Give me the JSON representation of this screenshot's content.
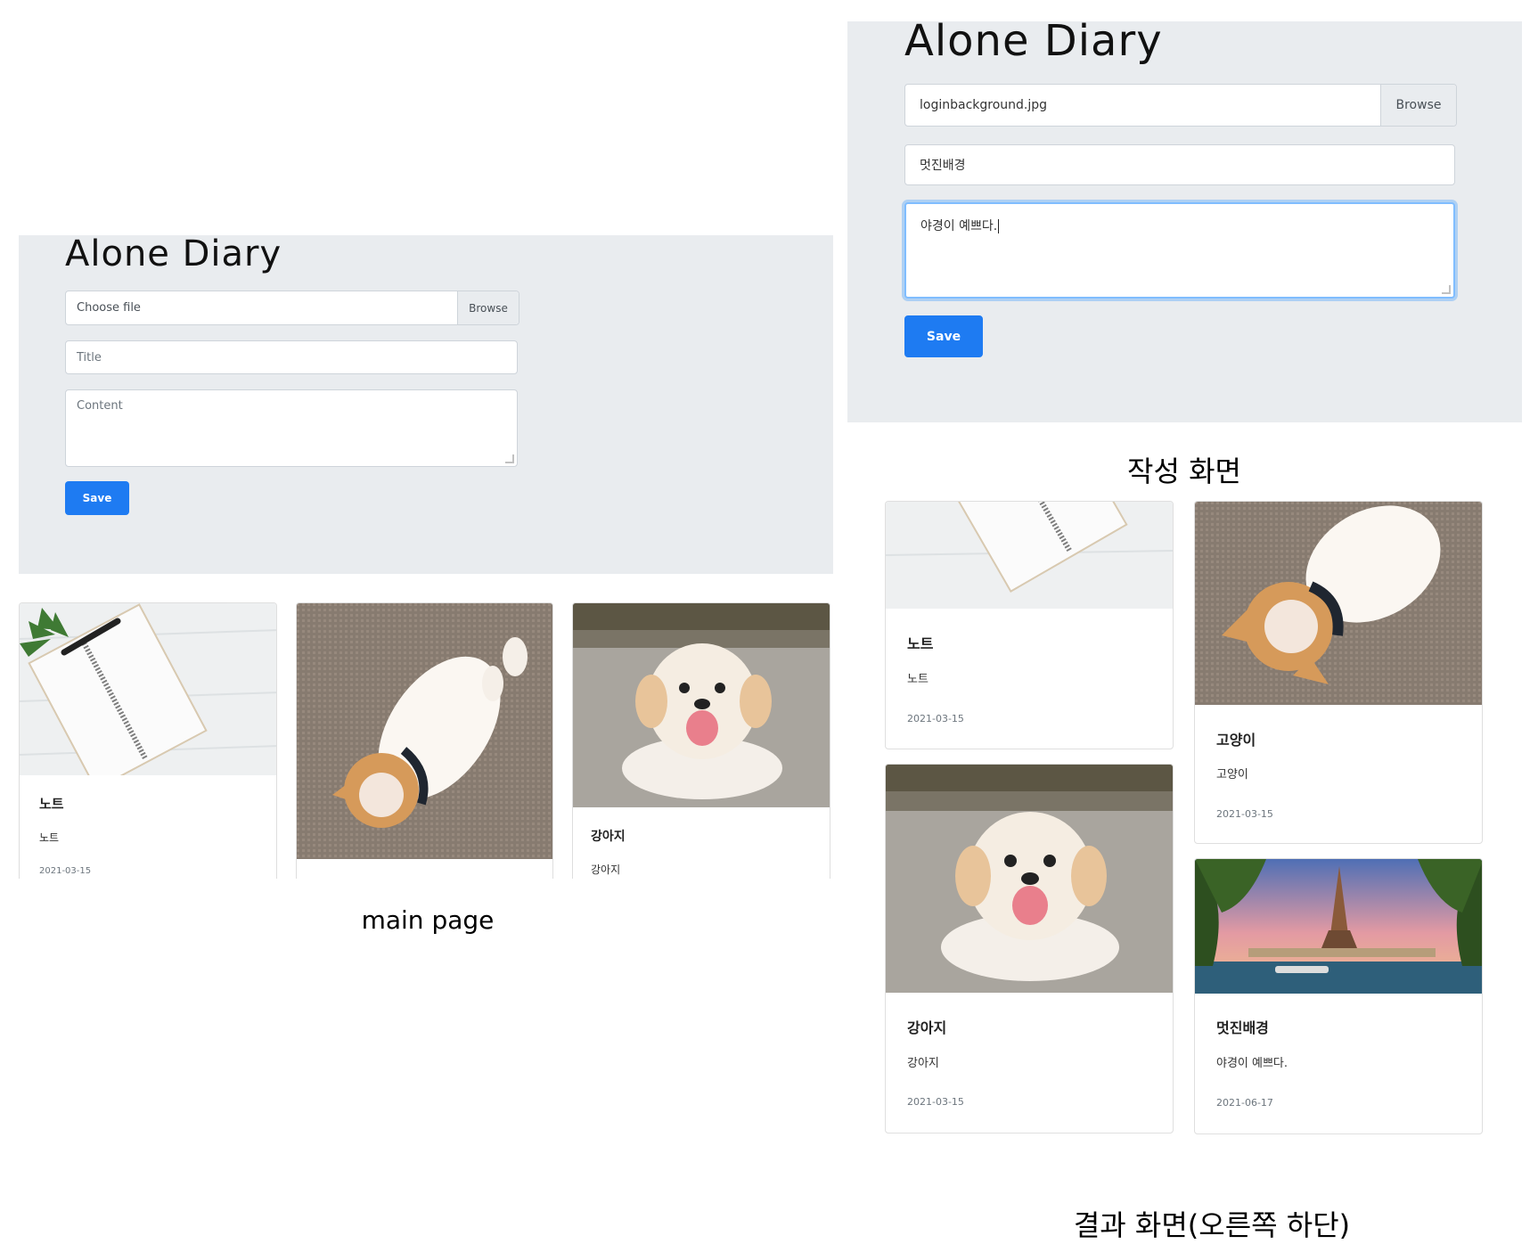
{
  "main_page": {
    "brand": "Alone Diary",
    "file_placeholder": "Choose file",
    "browse_label": "Browse",
    "title_placeholder": "Title",
    "content_placeholder": "Content",
    "save_label": "Save",
    "cards": [
      {
        "title": "노트",
        "text": "노트",
        "date": "2021-03-15",
        "image": "notebook"
      },
      {
        "title": "",
        "text": "",
        "date": "",
        "image": "cat"
      },
      {
        "title": "강아지",
        "text": "강아지",
        "date": "",
        "image": "puppy"
      }
    ],
    "caption": "main page"
  },
  "write_screen": {
    "brand": "Alone Diary",
    "file_value": "loginbackground.jpg",
    "browse_label": "Browse",
    "title_value": "멋진배경",
    "content_value": "야경이 예쁘다.",
    "save_label": "Save",
    "caption": "작성 화면"
  },
  "result_screen": {
    "cards": [
      {
        "title": "노트",
        "text": "노트",
        "date": "2021-03-15",
        "image": "notebook"
      },
      {
        "title": "고양이",
        "text": "고양이",
        "date": "2021-03-15",
        "image": "cat"
      },
      {
        "title": "강아지",
        "text": "강아지",
        "date": "2021-03-15",
        "image": "puppy"
      },
      {
        "title": "멋진배경",
        "text": "야경이 예쁘다.",
        "date": "2021-06-17",
        "image": "eiffel-tower"
      }
    ],
    "caption": "결과 화면(오른쪽 하단)"
  },
  "colors": {
    "panel_bg": "#e9ecef",
    "primary": "#1e7bf2",
    "focus_ring": "#80bdff"
  }
}
